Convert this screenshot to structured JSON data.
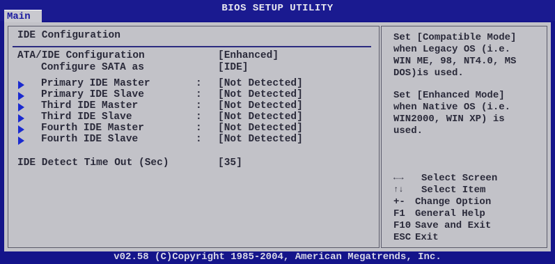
{
  "window": {
    "title": "BIOS SETUP UTILITY",
    "active_tab": "Main"
  },
  "main": {
    "section_title": "IDE Configuration",
    "settings": [
      {
        "label": "ATA/IDE Configuration",
        "value": "[Enhanced]"
      },
      {
        "label": "Configure SATA as",
        "value": "[IDE]"
      }
    ],
    "devices": [
      {
        "label": "Primary IDE Master",
        "value": "[Not Detected]"
      },
      {
        "label": "Primary IDE Slave",
        "value": "[Not Detected]"
      },
      {
        "label": "Third IDE Master",
        "value": "[Not Detected]"
      },
      {
        "label": "Third IDE Slave",
        "value": "[Not Detected]"
      },
      {
        "label": "Fourth IDE Master",
        "value": "[Not Detected]"
      },
      {
        "label": "Fourth IDE Slave",
        "value": "[Not Detected]"
      }
    ],
    "separator": ":",
    "timeout": {
      "label": "IDE Detect Time Out (Sec)",
      "value": "[35]"
    }
  },
  "help": {
    "paragraph1": [
      "Set [Compatible Mode]",
      "when Legacy OS (i.e.",
      "WIN ME, 98, NT4.0, MS",
      "DOS)is used."
    ],
    "paragraph2": [
      "Set [Enhanced Mode]",
      "when Native OS (i.e.",
      "WIN2000, WIN XP) is",
      "used."
    ]
  },
  "keys": [
    {
      "key": "←→",
      "desc": "Select Screen"
    },
    {
      "key": "↑↓",
      "desc": "Select Item"
    },
    {
      "key": "+-",
      "desc": "Change Option"
    },
    {
      "key": "F1",
      "desc": "General Help"
    },
    {
      "key": "F10",
      "desc": "Save and Exit"
    },
    {
      "key": "ESC",
      "desc": "Exit"
    }
  ],
  "footer": "v02.58 (C)Copyright 1985-2004, American Megatrends, Inc.",
  "colors": {
    "background": "#14148a",
    "panel": "#c2c2c8",
    "arrow": "#1a2ad0",
    "tab_text": "#1a1aa0"
  }
}
